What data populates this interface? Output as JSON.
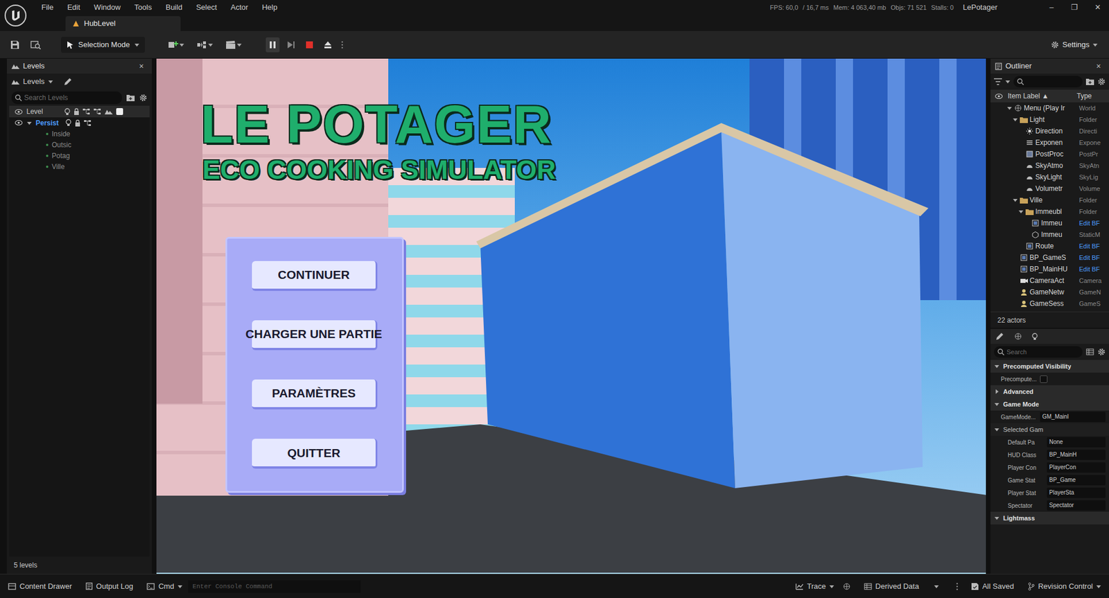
{
  "window": {
    "title": "HubLevel",
    "project": "LePotager",
    "menu": [
      "File",
      "Edit",
      "Window",
      "Tools",
      "Build",
      "Select",
      "Actor",
      "Help"
    ],
    "stats": {
      "fps": "FPS: 60,0",
      "ms": "/ 16,7 ms",
      "mem": "Mem: 4 063,40 mb",
      "objs": "Objs: 71 521",
      "stalls": "Stalls: 0"
    },
    "controls": [
      "–",
      "❐",
      "✕"
    ]
  },
  "toolbar": {
    "mode": "Selection Mode",
    "settings": "Settings",
    "playing": true
  },
  "levels": {
    "tab": "Levels",
    "close": "×",
    "dropdown": "Levels",
    "search_placeholder": "Search Levels",
    "header": "Level",
    "items": [
      {
        "name": "Persist",
        "kind": "persistent",
        "expanded": true,
        "selected": true
      },
      {
        "name": "Inside",
        "kind": "sublevel",
        "selected": false
      },
      {
        "name": "Outsic",
        "kind": "sublevel",
        "selected": false
      },
      {
        "name": "Potag",
        "kind": "sublevel",
        "selected": false
      },
      {
        "name": "Ville",
        "kind": "sublevel",
        "selected": false
      }
    ],
    "count": "5 levels"
  },
  "viewport": {
    "title": "LE POTAGER",
    "subtitle": "ECO COOKING SIMULATOR",
    "buttons": [
      "CONTINUER",
      "CHARGER UNE PARTIE",
      "PARAMÈTRES",
      "QUITTER"
    ]
  },
  "outliner": {
    "tab": "Outliner",
    "close": "×",
    "columns": [
      "Item Label ▲",
      "Type"
    ],
    "rows": [
      {
        "label": "Menu (Play Ir",
        "type": "World",
        "depth": 0,
        "kind": "world",
        "expanded": true,
        "link": false
      },
      {
        "label": "Light",
        "type": "Folder",
        "depth": 1,
        "kind": "folder",
        "expanded": true,
        "link": false
      },
      {
        "label": "Direction",
        "type": "Directi",
        "depth": 2,
        "kind": "light",
        "link": false
      },
      {
        "label": "Exponen",
        "type": "Expone",
        "depth": 2,
        "kind": "fog",
        "link": false
      },
      {
        "label": "PostProc",
        "type": "PostPr",
        "depth": 2,
        "kind": "volume",
        "link": false
      },
      {
        "label": "SkyAtmo",
        "type": "SkyAtn",
        "depth": 2,
        "kind": "sky",
        "link": false
      },
      {
        "label": "SkyLight",
        "type": "SkyLig",
        "depth": 2,
        "kind": "sky",
        "link": false
      },
      {
        "label": "Volumetr",
        "type": "Volume",
        "depth": 2,
        "kind": "sky",
        "link": false
      },
      {
        "label": "Ville",
        "type": "Folder",
        "depth": 1,
        "kind": "folder",
        "expanded": true,
        "link": false
      },
      {
        "label": "Immeubl",
        "type": "Folder",
        "depth": 2,
        "kind": "folder",
        "expanded": true,
        "link": false
      },
      {
        "label": "Immeu",
        "type": "Edit BF",
        "depth": 3,
        "kind": "blueprint",
        "link": true
      },
      {
        "label": "Immeu",
        "type": "StaticM",
        "depth": 3,
        "kind": "mesh",
        "link": false
      },
      {
        "label": "Route",
        "type": "Edit BF",
        "depth": 2,
        "kind": "blueprint",
        "link": true
      },
      {
        "label": "BP_GameS",
        "type": "Edit BF",
        "depth": 1,
        "kind": "blueprint",
        "link": true
      },
      {
        "label": "BP_MainHU",
        "type": "Edit BF",
        "depth": 1,
        "kind": "blueprint",
        "link": true
      },
      {
        "label": "CameraAct",
        "type": "Camera",
        "depth": 1,
        "kind": "camera",
        "link": false
      },
      {
        "label": "GameNetw",
        "type": "GameN",
        "depth": 1,
        "kind": "game",
        "link": false
      },
      {
        "label": "GameSess",
        "type": "GameS",
        "depth": 1,
        "kind": "game",
        "link": false
      }
    ],
    "count": "22 actors"
  },
  "details": {
    "search_placeholder": "Search",
    "sections": [
      {
        "title": "Precomputed Visibility",
        "expanded": true,
        "sub": false,
        "props": [
          {
            "label": "Precompute...",
            "kind": "checkbox",
            "checked": false
          }
        ]
      },
      {
        "title": "Advanced",
        "expanded": false,
        "sub": false,
        "props": []
      },
      {
        "title": "Game Mode",
        "expanded": true,
        "sub": false,
        "props": [
          {
            "label": "GameMode...",
            "kind": "value",
            "value": "GM_MainI"
          }
        ]
      },
      {
        "title": "Selected Gam",
        "expanded": true,
        "sub": true,
        "props": [
          {
            "label": "Default Pa",
            "kind": "value",
            "value": "None"
          },
          {
            "label": "HUD Class",
            "kind": "value",
            "value": "BP_MainH"
          },
          {
            "label": "Player Con",
            "kind": "value",
            "value": "PlayerCon"
          },
          {
            "label": "Game Stat",
            "kind": "value",
            "value": "BP_Game"
          },
          {
            "label": "Player Stat",
            "kind": "value",
            "value": "PlayerSta"
          },
          {
            "label": "Spectator",
            "kind": "value",
            "value": "Spectator"
          }
        ]
      },
      {
        "title": "Lightmass",
        "expanded": true,
        "sub": false,
        "props": []
      }
    ]
  },
  "status_bar": {
    "content_drawer": "Content Drawer",
    "output_log": "Output Log",
    "cmd": "Cmd",
    "console_placeholder": "Enter Console Command",
    "trace": "Trace",
    "derived_data": "Derived Data",
    "saved": "All Saved",
    "revision": "Revision Control"
  }
}
